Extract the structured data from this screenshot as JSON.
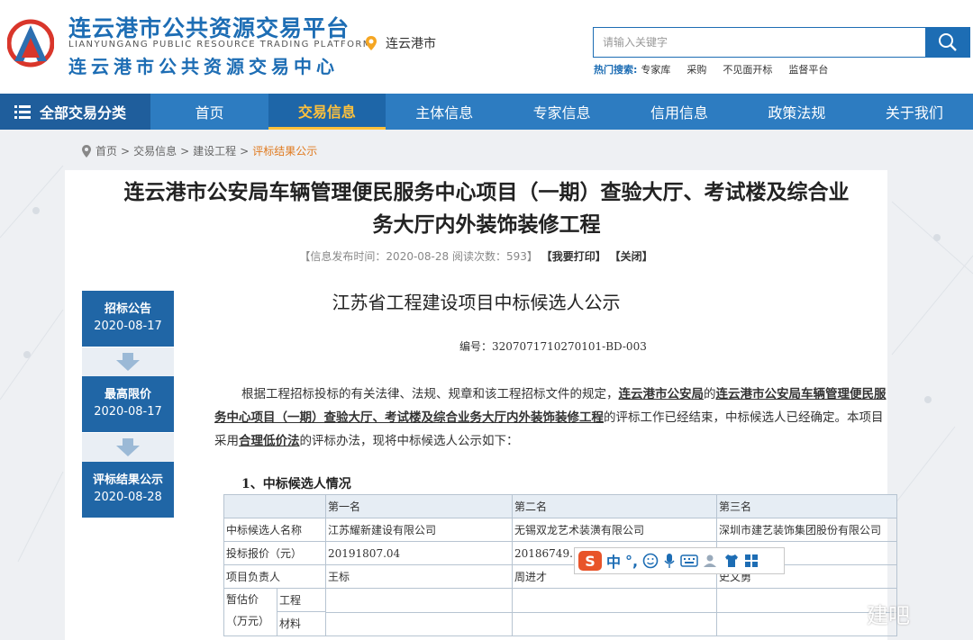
{
  "header": {
    "logo_cn": "连云港市公共资源交易平台",
    "logo_en": "LIANYUNGANG PUBLIC RESOURCE TRADING PLATFORM",
    "logo_cn2": "连云港市公共资源交易中心",
    "location": "连云港市",
    "search_placeholder": "请输入关键字",
    "hot_label": "热门搜索:",
    "hot_items": [
      "专家库",
      "采购",
      "不见面开标",
      "监督平台"
    ]
  },
  "nav": {
    "all_label": "全部交易分类",
    "items": [
      "首页",
      "交易信息",
      "主体信息",
      "专家信息",
      "信用信息",
      "政策法规",
      "关于我们"
    ],
    "active_index": 1
  },
  "breadcrumb": [
    "首页",
    "交易信息",
    "建设工程",
    "评标结果公示"
  ],
  "article": {
    "title_line1": "连云港市公安局车辆管理便民服务中心项目（一期）查验大厅、考试楼及综合业",
    "title_line2": "务大厅内外装饰装修工程",
    "meta_prefix": "【信息发布时间：2020-08-28  阅读次数：593】",
    "print": "【我要打印】",
    "close": "【关闭】"
  },
  "timeline": [
    {
      "title": "招标公告",
      "date": "2020-08-17"
    },
    {
      "title": "最高限价",
      "date": "2020-08-17"
    },
    {
      "title": "评标结果公示",
      "date": "2020-08-28"
    }
  ],
  "doc": {
    "title": "江苏省工程建设项目中标候选人公示",
    "number": "编号：3207071710270101-BD-003",
    "para_a": "根据工程招标投标的有关法律、法规、规章和该工程招标文件的规定，",
    "para_u1": "连云港市公安局",
    "para_b": "的",
    "para_u2": "连云港市公安局车辆管理便民服务中心项目（一期）查验大厅、考试楼及综合业务大厅内外装饰装修工程",
    "para_c": "的评标工作已经结束，中标候选人已经确定。本项目采用",
    "para_u3": "合理低价法",
    "para_d": "的评标办法，现将中标候选人公示如下：",
    "section": "1、中标候选人情况"
  },
  "table": {
    "header": [
      "",
      "第一名",
      "第二名",
      "第三名"
    ],
    "rows": [
      [
        "中标候选人名称",
        "江苏耀新建设有限公司",
        "无锡双龙艺术装潢有限公司",
        "深圳市建艺装饰集团股份有限公司"
      ],
      [
        "投标报价（元）",
        "20191807.04",
        "20186749.16",
        ""
      ],
      [
        "项目负责人",
        "王标",
        "周进才",
        "史文勇"
      ]
    ],
    "est_label": "暂估价（万元）",
    "est_sub1": "工程",
    "est_sub2": "材料"
  },
  "ime": {
    "lang": "中",
    "punct": "°,"
  },
  "watermark": "建吧",
  "colors": {
    "brand": "#1d6db4",
    "nav": "#2d7cc1",
    "accent": "#ffc13b",
    "timeline": "#2066a6"
  }
}
